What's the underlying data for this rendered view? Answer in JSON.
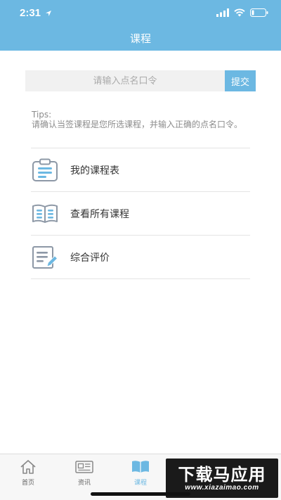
{
  "status": {
    "time": "2:31"
  },
  "nav": {
    "title": "课程"
  },
  "search": {
    "placeholder": "请输入点名口令",
    "submit_label": "提交"
  },
  "tips": {
    "heading": "Tips:",
    "text": "请确认当签课程是您所选课程，并输入正确的点名口令。"
  },
  "menu": {
    "items": [
      {
        "label": "我的课程表",
        "icon": "clipboard-icon"
      },
      {
        "label": "查看所有课程",
        "icon": "open-book-icon"
      },
      {
        "label": "综合评价",
        "icon": "edit-document-icon"
      }
    ]
  },
  "tabbar": {
    "items": [
      {
        "label": "首页",
        "icon": "home-icon"
      },
      {
        "label": "资讯",
        "icon": "news-icon"
      },
      {
        "label": "课程",
        "icon": "course-book-icon",
        "active": true
      },
      {
        "label": "",
        "icon": "people-icon"
      },
      {
        "label": "",
        "icon": "profile-icon"
      }
    ]
  },
  "watermark": {
    "text": "下载马应用",
    "url": "www.xiazaimao.com"
  },
  "colors": {
    "accent": "#6cb8e2",
    "background": "#ffffff",
    "divider": "#e4e4e4"
  }
}
